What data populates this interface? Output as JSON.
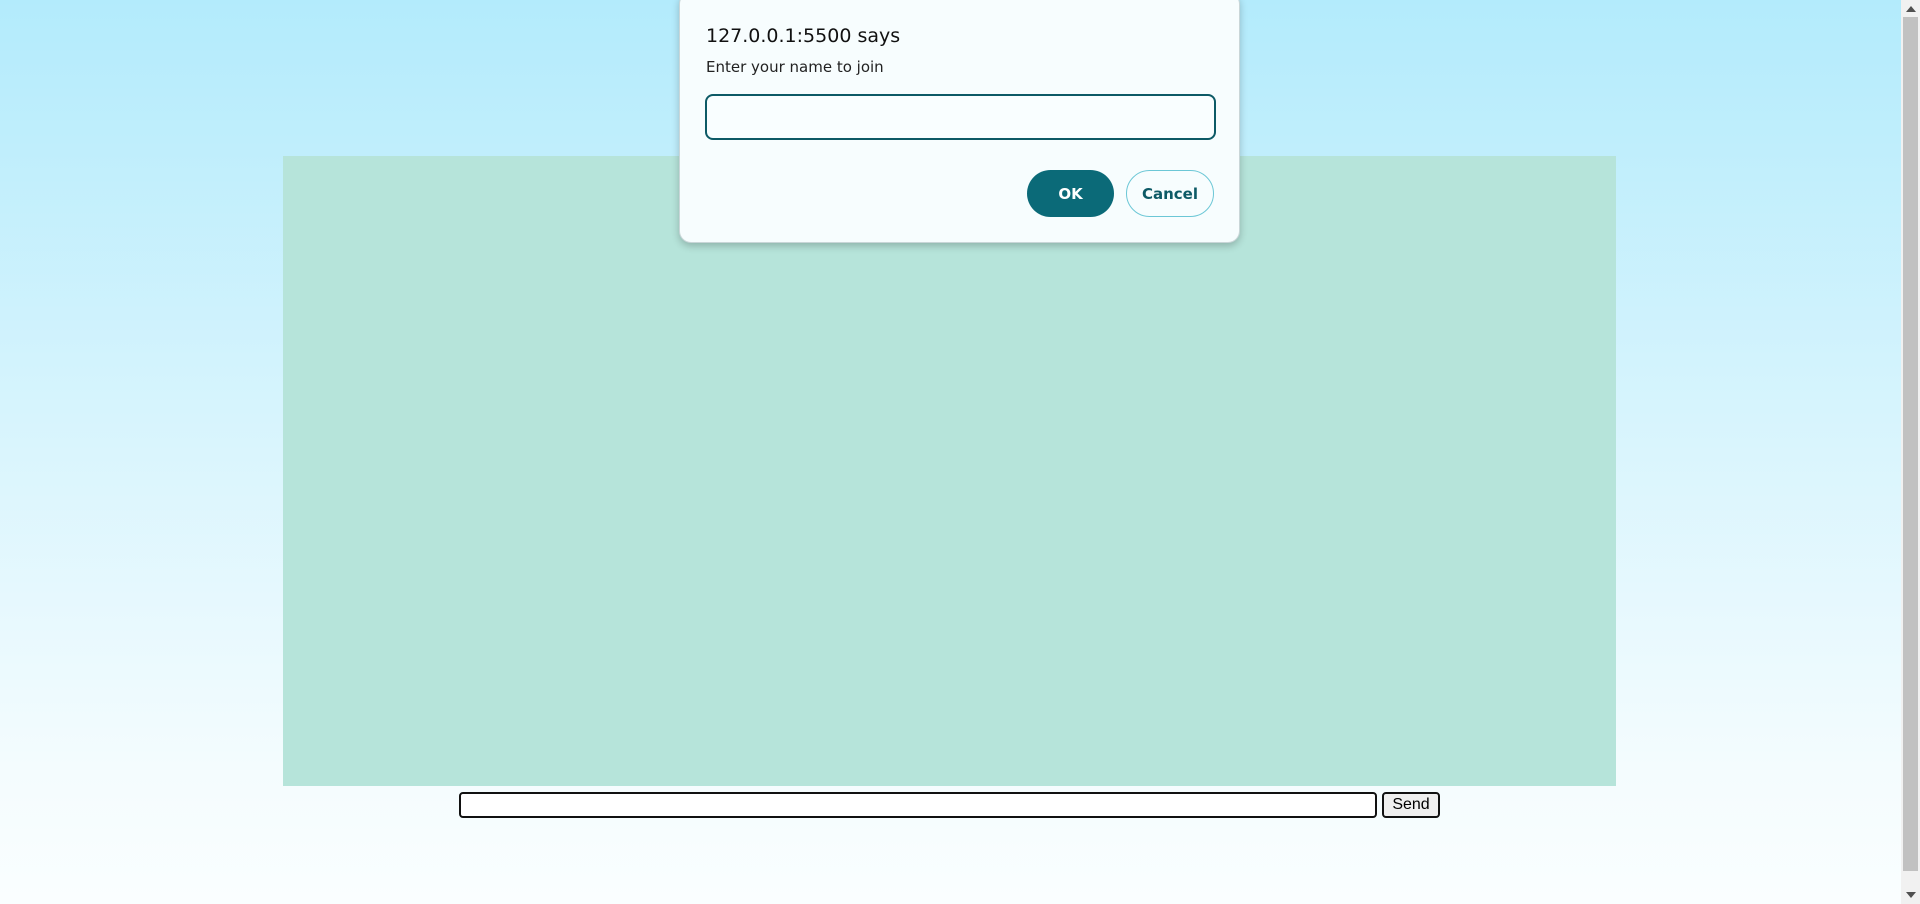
{
  "dialog": {
    "title": "127.0.0.1:5500 says",
    "message": "Enter your name to join",
    "input_value": "",
    "ok_label": "OK",
    "cancel_label": "Cancel"
  },
  "chat": {
    "message_input_value": "",
    "send_label": "Send"
  },
  "colors": {
    "chat_box": "#b6e4da",
    "ok_button": "#0b6a78",
    "dialog_border_input": "#0d5a66"
  }
}
